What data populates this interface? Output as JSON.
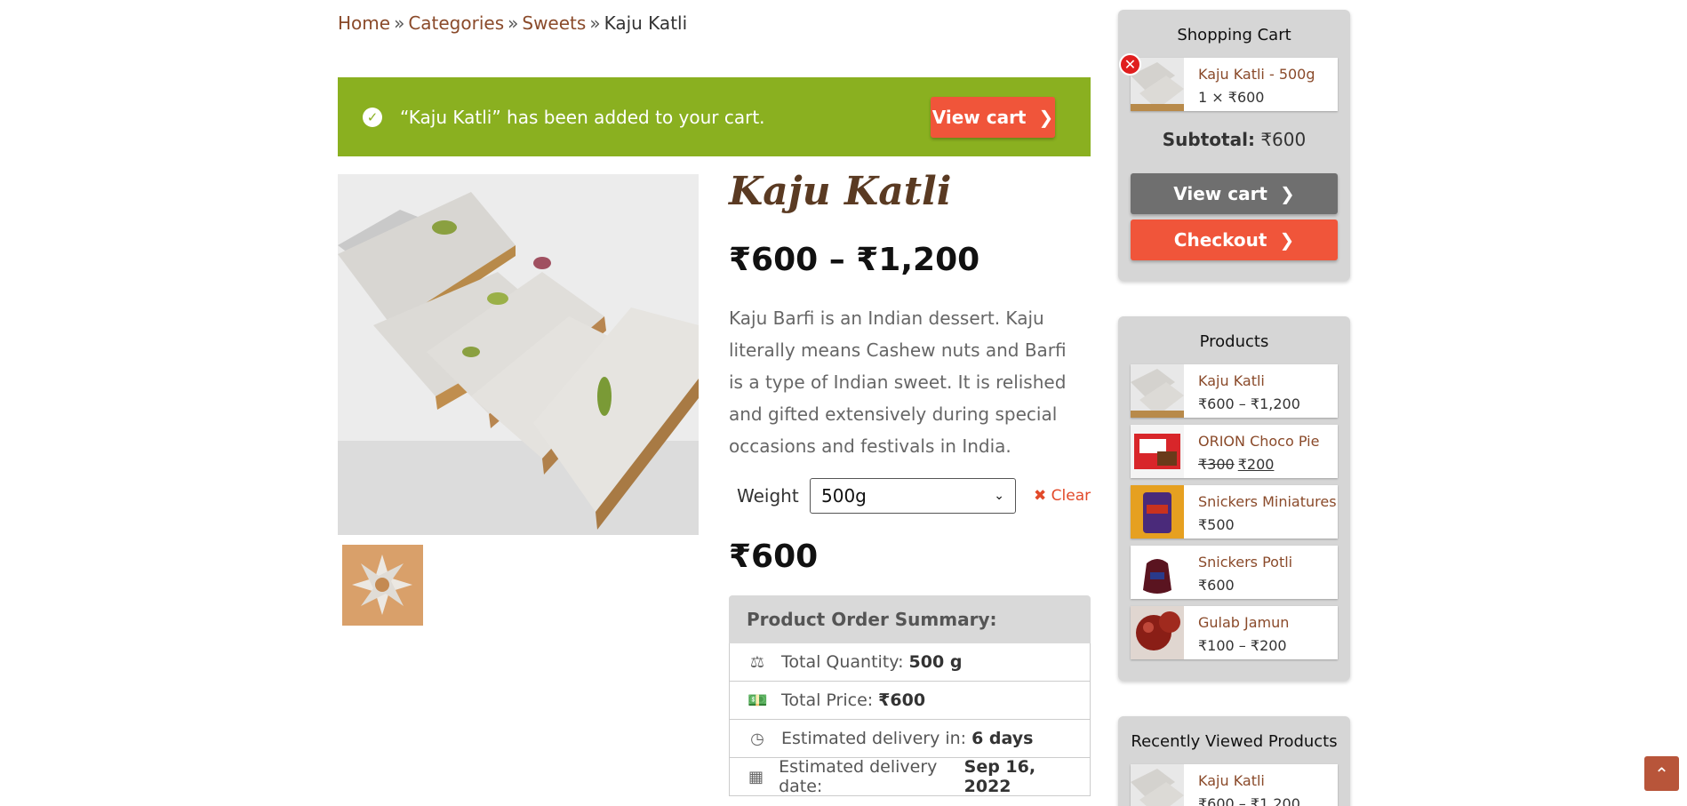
{
  "breadcrumb": {
    "home": "Home",
    "categories": "Categories",
    "sweets": "Sweets",
    "current": "Kaju Katli",
    "separator": "»"
  },
  "notice": {
    "message": "“Kaju Katli” has been added to your cart.",
    "button": "View cart",
    "color": "#8ab020"
  },
  "product": {
    "title": "Kaju Katli",
    "price_range": "₹600 – ₹1,200",
    "description": "Kaju Barfi is an Indian dessert. Kaju literally means Cashew nuts and Barfi is a type of Indian sweet. It is relished and gifted extensively during special occasions and festivals in India.",
    "weight_label": "Weight",
    "weight_selected": "500g",
    "clear_label": "Clear",
    "selected_price": "₹600"
  },
  "summary": {
    "heading": "Product Order Summary:",
    "rows": [
      {
        "label": "Total Quantity:",
        "value": "500 g",
        "icon": "scale-icon"
      },
      {
        "label": "Total Price:",
        "value": "₹600",
        "icon": "money-icon"
      },
      {
        "label": "Estimated delivery in:",
        "value": "6 days",
        "icon": "clock-icon"
      },
      {
        "label": "Estimated delivery date:",
        "value": "Sep 16, 2022",
        "icon": "calendar-icon"
      }
    ]
  },
  "cart": {
    "title": "Shopping Cart",
    "item": {
      "name": "Kaju Katli - 500g",
      "qty": "1 × ₹600"
    },
    "subtotal_label": "Subtotal:",
    "subtotal_value": "₹600",
    "view_cart": "View cart",
    "checkout": "Checkout"
  },
  "products": {
    "title": "Products",
    "items": [
      {
        "name": "Kaju Katli",
        "price": "₹600 – ₹1,200"
      },
      {
        "name": "ORION Choco Pie",
        "old_price": "₹300",
        "price": "₹200"
      },
      {
        "name": "Snickers Miniatures",
        "price": "₹500"
      },
      {
        "name": "Snickers Potli",
        "price": "₹600"
      },
      {
        "name": "Gulab Jamun",
        "price": "₹100 – ₹200"
      }
    ]
  },
  "recently_viewed": {
    "title": "Recently Viewed Products",
    "items": [
      {
        "name": "Kaju Katli",
        "price": "₹600 – ₹1,200"
      }
    ]
  },
  "colors": {
    "accent": "#f0553a",
    "link": "#8a4a2a",
    "success": "#8ab020"
  }
}
